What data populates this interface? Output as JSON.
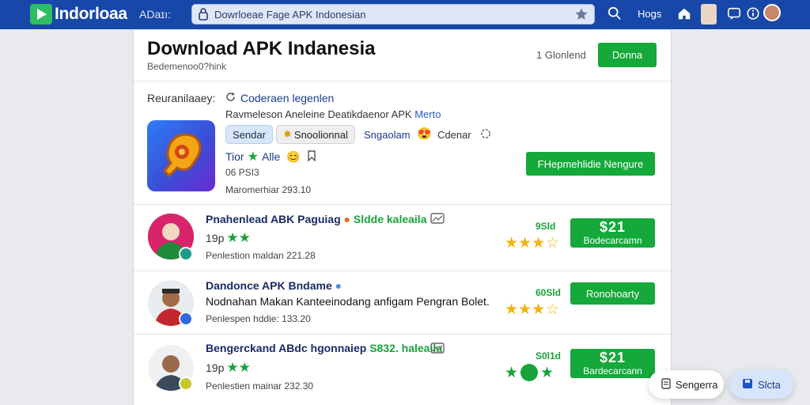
{
  "topbar": {
    "logo_text": "Indorloaa",
    "link": "ADaɪı:",
    "search_value": "Dowrloeae Fage APK Indonesian",
    "right_label": "Hoɡs"
  },
  "header": {
    "title": "Download APK Indanesia",
    "subtitle": "Bedemenoo0?hink",
    "count": "1 Glonlend",
    "button": "Donna"
  },
  "featured": {
    "label": "Reuranilaaey:",
    "link": "Coderaen legenlen",
    "desc_prefix": "Ravmeleson Aneleine Deatikdaenor APK",
    "desc_link": "Merto",
    "chips": [
      "Sendar",
      "Snoolionnal",
      "Sngaolam",
      "Cdenar"
    ],
    "rating_label": "Tior",
    "rating_value": "Alle",
    "meta_1": "06 PSI3",
    "meta_2": "Maromerhiar 293.10",
    "button": "FHepmehlidie Nengure"
  },
  "rows": [
    {
      "title": "Pnahenlead ABK Paguiag",
      "tag": "Sldde kaleaila",
      "desc": "",
      "stars_label": "19p",
      "date": "Penlestion maldan 221.28",
      "size": "9Sld",
      "btn_big": "$21",
      "btn_small": "Bodecarcamn",
      "gold_stars": 2.5
    },
    {
      "title": "Dandonce APK Bndame",
      "tag": "",
      "desc": "Nodnahan Makan Kanteeinodang anfigam Pengran Bolet.",
      "stars_label": "",
      "date": "Penlespen hddie: 133.20",
      "size": "60Sld",
      "btn_big": "",
      "btn_small": "Ronohoarty",
      "gold_stars": 3
    },
    {
      "title": "Bengerckand ABdc hgonnaiep",
      "tag": "S832. haleaila",
      "desc": "",
      "stars_label": "19p",
      "date": "Penlestien mainar 232.30",
      "size": "S0l1d",
      "btn_big": "$21",
      "btn_small": "Bardecarcann",
      "gold_stars": 2
    }
  ],
  "floating": {
    "left": "Sengerra",
    "right": "Slcta"
  },
  "colors": {
    "brand_blue": "#1747a8",
    "accent_green": "#15a83a",
    "star_gold": "#f2b311"
  }
}
